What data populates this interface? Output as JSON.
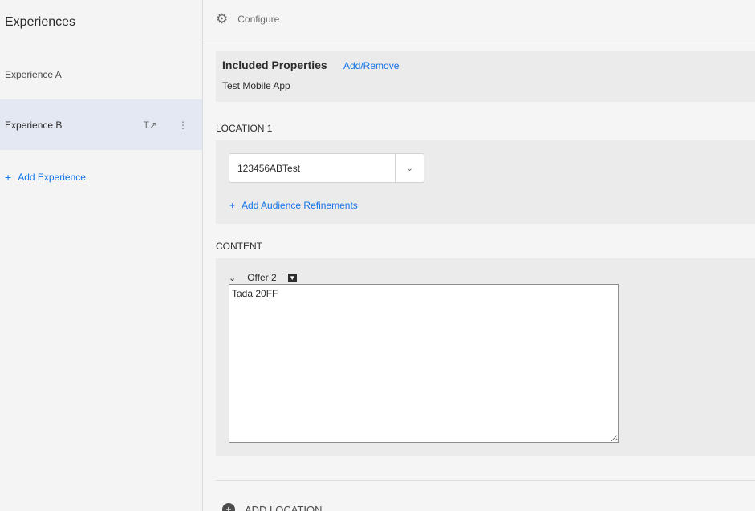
{
  "sidebar": {
    "title": "Experiences",
    "items": [
      {
        "label": "Experience A"
      },
      {
        "label": "Experience B"
      }
    ],
    "add_label": "Add Experience"
  },
  "topbar": {
    "icon": "gear-icon",
    "label": "Configure"
  },
  "properties": {
    "title": "Included Properties",
    "link": "Add/Remove",
    "value": "Test Mobile App"
  },
  "location": {
    "label": "LOCATION 1",
    "selected": "123456ABTest",
    "add_refinements": "Add Audience Refinements"
  },
  "content": {
    "label": "CONTENT",
    "offer_name": "Offer 2",
    "offer_text": "Tada 20FF"
  },
  "add_location_label": "ADD LOCATION",
  "colors": {
    "accent": "#1473e6",
    "selected_bg": "#e4e8f2"
  }
}
